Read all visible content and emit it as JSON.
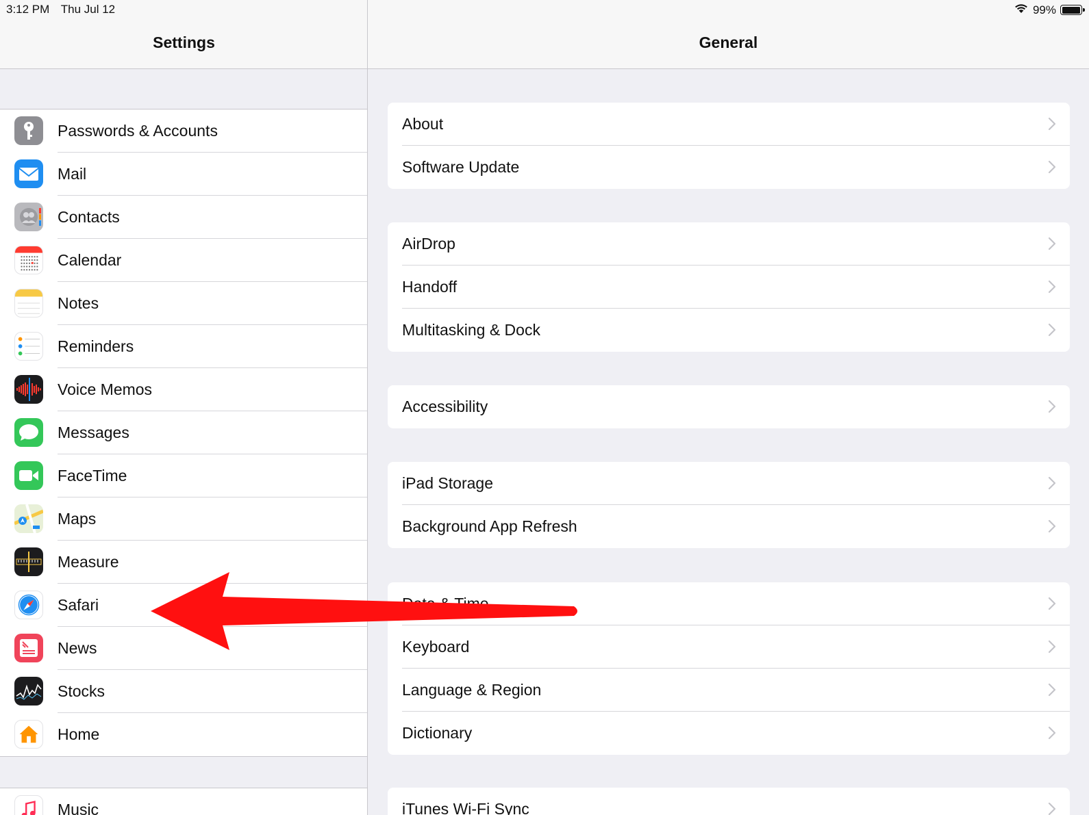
{
  "status_bar": {
    "time": "3:12 PM",
    "date": "Thu Jul 12",
    "battery": "99%",
    "battery_level": 0.99
  },
  "master": {
    "title": "Settings",
    "items": [
      {
        "label": "Passwords & Accounts",
        "icon": "key-icon",
        "color": "#8e8e93"
      },
      {
        "label": "Mail",
        "icon": "mail-icon",
        "color": "#1f8ef1"
      },
      {
        "label": "Contacts",
        "icon": "contacts-icon",
        "color": "#b9b9bd"
      },
      {
        "label": "Calendar",
        "icon": "calendar-icon",
        "color": "#ffffff"
      },
      {
        "label": "Notes",
        "icon": "notes-icon",
        "color": "#ffffff"
      },
      {
        "label": "Reminders",
        "icon": "reminders-icon",
        "color": "#ffffff"
      },
      {
        "label": "Voice Memos",
        "icon": "voice-memos-icon",
        "color": "#1c1c1e"
      },
      {
        "label": "Messages",
        "icon": "messages-icon",
        "color": "#34c759"
      },
      {
        "label": "FaceTime",
        "icon": "facetime-icon",
        "color": "#34c759"
      },
      {
        "label": "Maps",
        "icon": "maps-icon",
        "color": "#e8f0d8"
      },
      {
        "label": "Measure",
        "icon": "measure-icon",
        "color": "#1c1c1e"
      },
      {
        "label": "Safari",
        "icon": "safari-icon",
        "color": "#ffffff"
      },
      {
        "label": "News",
        "icon": "news-icon",
        "color": "#f0445a"
      },
      {
        "label": "Stocks",
        "icon": "stocks-icon",
        "color": "#1c1c1e"
      },
      {
        "label": "Home",
        "icon": "home-icon",
        "color": "#ffffff"
      }
    ],
    "items2": [
      {
        "label": "Music",
        "icon": "music-icon",
        "color": "#ffffff"
      }
    ]
  },
  "detail": {
    "title": "General",
    "groups": [
      [
        "About",
        "Software Update"
      ],
      [
        "AirDrop",
        "Handoff",
        "Multitasking & Dock"
      ],
      [
        "Accessibility"
      ],
      [
        "iPad Storage",
        "Background App Refresh"
      ],
      [
        "Date & Time",
        "Keyboard",
        "Language & Region",
        "Dictionary"
      ],
      [
        "iTunes Wi-Fi Sync"
      ]
    ]
  },
  "annotation": {
    "arrow_color": "#ff1010",
    "arrow_icon": "red-arrow-pointing-left"
  }
}
